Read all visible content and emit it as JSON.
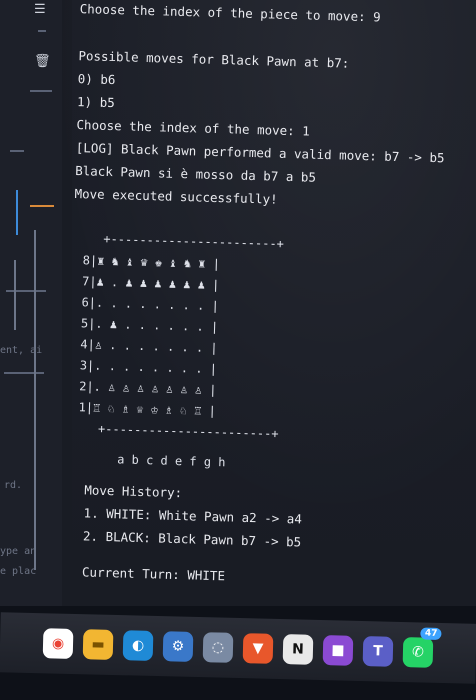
{
  "terminal": {
    "lines": [
      "Choose the index of the piece to move: 9",
      "Possible moves for Black Pawn at b7:",
      "0) b6",
      "1) b5",
      "Choose the index of the move: 1",
      "[LOG] Black Pawn performed a valid move: b7 -> b5",
      "Black Pawn si è mosso da b7 a b5",
      "Move executed successfully!"
    ],
    "board_border_top": "+-----------------------+",
    "board_rows": [
      "8|♜ ♞ ♝ ♛ ♚ ♝ ♞ ♜ |",
      "7|♟ . ♟ ♟ ♟ ♟ ♟ ♟ |",
      "6|. . . . . . . . |",
      "5|. ♟ . . . . . . |",
      "4|♙ . . . . . . . |",
      "3|. . . . . . . . |",
      "2|. ♙ ♙ ♙ ♙ ♙ ♙ ♙ |",
      "1|♖ ♘ ♗ ♕ ♔ ♗ ♘ ♖ |"
    ],
    "board_border_bottom": "+-----------------------+",
    "file_labels": "a b c d e f g h",
    "history_title": "Move History:",
    "history": [
      "1. WHITE: White Pawn a2 -> a4",
      "2. BLACK: Black Pawn b7 -> b5"
    ],
    "current_turn": "Current Turn: WHITE"
  },
  "editor_strip": {
    "fragments": [
      "ent, ai",
      "rd.",
      "ype an",
      "e plac"
    ]
  },
  "taskbar": {
    "apps": [
      {
        "name": "chrome-icon",
        "glyph": "◉",
        "color": "#ea4335"
      },
      {
        "name": "file-explorer-icon",
        "glyph": "▬",
        "color": "#f2b632"
      },
      {
        "name": "edge-icon",
        "glyph": "◐",
        "color": "#1f8ad6"
      },
      {
        "name": "settings-icon",
        "glyph": "⚙",
        "color": "#3a78c9"
      },
      {
        "name": "gallery-icon",
        "glyph": "◌",
        "color": "#7a8aa3"
      },
      {
        "name": "brave-icon",
        "glyph": "▼",
        "color": "#e8572b"
      },
      {
        "name": "notion-icon",
        "glyph": "N",
        "color": "#e9e9e9"
      },
      {
        "name": "app-icon",
        "glyph": "■",
        "color": "#8b4ad3"
      },
      {
        "name": "teams-icon",
        "glyph": "T",
        "color": "#5b5fc7"
      },
      {
        "name": "whatsapp-icon",
        "glyph": "✆",
        "color": "#25d366"
      }
    ],
    "whatsapp_badge": "47"
  }
}
